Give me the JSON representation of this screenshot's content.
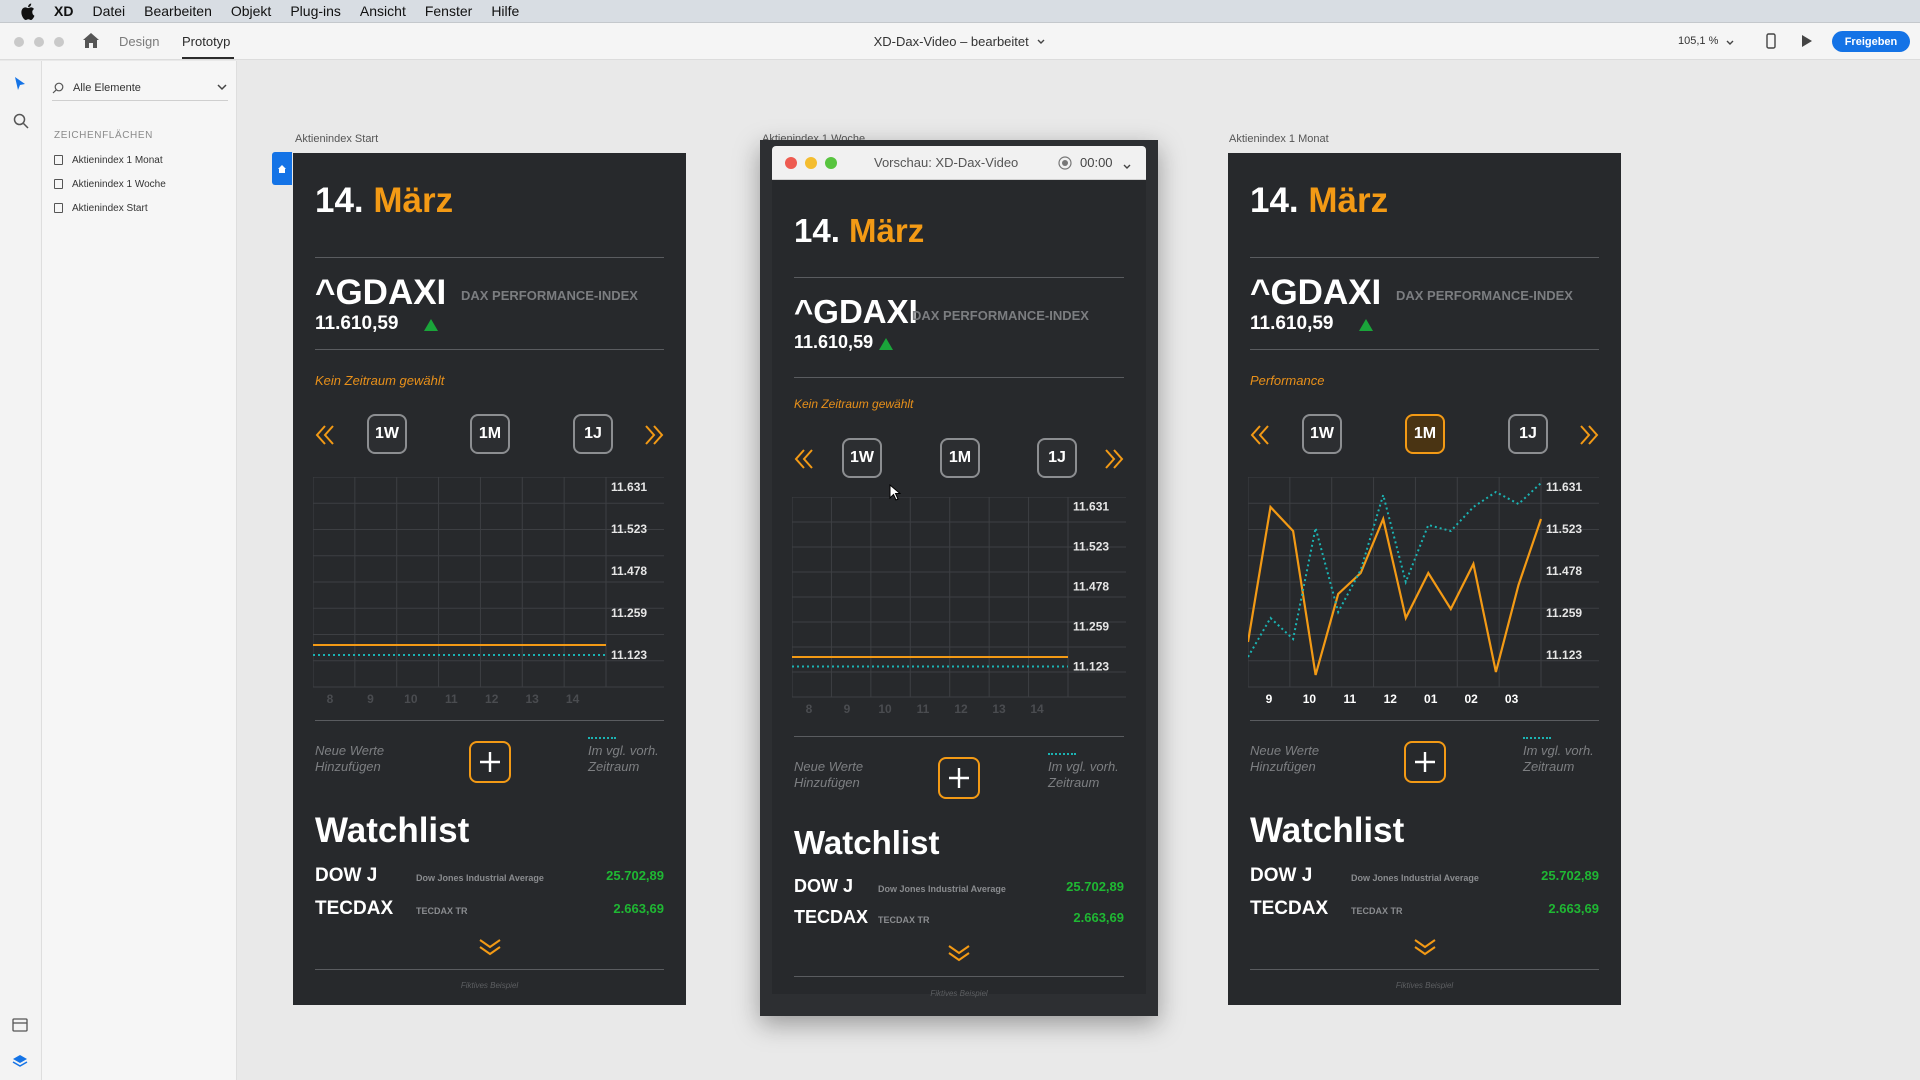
{
  "menubar": {
    "app": "XD",
    "items": [
      "Datei",
      "Bearbeiten",
      "Objekt",
      "Plug-ins",
      "Ansicht",
      "Fenster",
      "Hilfe"
    ]
  },
  "toolbar": {
    "tab_design": "Design",
    "tab_prototyp": "Prototyp",
    "doc_title": "XD-Dax-Video – bearbeitet",
    "zoom": "105,1 %",
    "share_label": "Freigeben"
  },
  "layers": {
    "search_label": "Alle Elemente",
    "heading": "ZEICHENFLÄCHEN",
    "items": [
      "Aktienindex 1 Monat",
      "Aktienindex 1 Woche",
      "Aktienindex Start"
    ]
  },
  "preview": {
    "title": "Vorschau: XD-Dax-Video",
    "time": "00:00"
  },
  "accent": "#f39a15",
  "artboards": [
    {
      "label": "Aktienindex Start",
      "day": "14.",
      "month": "März",
      "symbol": "^GDAXI",
      "index_name": "DAX PERFORMANCE-INDEX",
      "price": "11.610,59",
      "hint": "Kein Zeitraum gewählt",
      "periods": [
        "1W",
        "1M",
        "1J"
      ],
      "y_ticks": [
        "11.631",
        "11.523",
        "11.478",
        "11.259",
        "11.123"
      ],
      "x_ticks": [
        "8",
        "9",
        "10",
        "11",
        "12",
        "13",
        "14"
      ],
      "add_label_1": "Neue Werte",
      "add_label_2": "Hinzufügen",
      "compare_1": "Im vgl. vorh.",
      "compare_2": "Zeitraum",
      "watchlist_title": "Watchlist",
      "wl": [
        {
          "sym": "DOW J",
          "name": "Dow Jones Industrial Average",
          "val": "25.702,89"
        },
        {
          "sym": "TECDAX",
          "name": "TECDAX TR",
          "val": "2.663,69"
        }
      ],
      "footer": "Fiktives Beispiel"
    },
    {
      "label": "Aktienindex 1 Woche",
      "day": "14.",
      "month": "März",
      "symbol": "^GDAXI",
      "index_name": "DAX PERFORMANCE-INDEX",
      "price": "11.610,59",
      "hint": "Kein Zeitraum gewählt",
      "periods": [
        "1W",
        "1M",
        "1J"
      ],
      "y_ticks": [
        "11.631",
        "11.523",
        "11.478",
        "11.259",
        "11.123"
      ],
      "x_ticks": [
        "8",
        "9",
        "10",
        "11",
        "12",
        "13",
        "14"
      ],
      "add_label_1": "Neue Werte",
      "add_label_2": "Hinzufügen",
      "compare_1": "Im vgl. vorh.",
      "compare_2": "Zeitraum",
      "watchlist_title": "Watchlist",
      "wl": [
        {
          "sym": "DOW J",
          "name": "Dow Jones Industrial Average",
          "val": "25.702,89"
        },
        {
          "sym": "TECDAX",
          "name": "TECDAX TR",
          "val": "2.663,69"
        }
      ],
      "footer": "Fiktives Beispiel"
    },
    {
      "label": "Aktienindex 1 Monat",
      "day": "14.",
      "month": "März",
      "symbol": "^GDAXI",
      "index_name": "DAX PERFORMANCE-INDEX",
      "price": "11.610,59",
      "hint": "Performance",
      "periods": [
        "1W",
        "1M",
        "1J"
      ],
      "y_ticks": [
        "11.631",
        "11.523",
        "11.478",
        "11.259",
        "11.123"
      ],
      "x_ticks": [
        "9",
        "10",
        "11",
        "12",
        "01",
        "02",
        "03"
      ],
      "add_label_1": "Neue Werte",
      "add_label_2": "Hinzufügen",
      "compare_1": "Im vgl. vorh.",
      "compare_2": "Zeitraum",
      "watchlist_title": "Watchlist",
      "wl": [
        {
          "sym": "DOW J",
          "name": "Dow Jones Industrial Average",
          "val": "25.702,89"
        },
        {
          "sym": "TECDAX",
          "name": "TECDAX TR",
          "val": "2.663,69"
        }
      ],
      "footer": "Fiktives Beispiel"
    }
  ],
  "chart_data": {
    "type": "line",
    "x": [
      "9",
      "10",
      "11",
      "12",
      "01",
      "02",
      "03"
    ],
    "ylim": [
      11000,
      11700
    ],
    "series": [
      {
        "values": [
          11150,
          11600,
          11520,
          11040,
          11310,
          11380,
          11560,
          11230,
          11380,
          11260,
          11410,
          11050,
          11340,
          11560
        ]
      },
      {
        "values": [
          11100,
          11230,
          11160,
          11530,
          11250,
          11390,
          11640,
          11350,
          11540,
          11520,
          11600,
          11650,
          11610,
          11680
        ]
      }
    ]
  }
}
